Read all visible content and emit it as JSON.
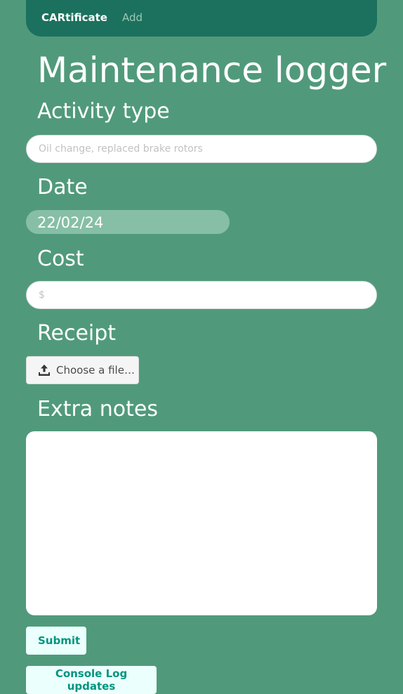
{
  "navbar": {
    "brand": "CARtificate",
    "add_link": "Add"
  },
  "page": {
    "title": "Maintenance logger"
  },
  "form": {
    "activity_label": "Activity type",
    "activity_placeholder": "Oil change, replaced brake rotors",
    "date_label": "Date",
    "date_value": "22/02/24",
    "cost_label": "Cost",
    "cost_placeholder": "$",
    "receipt_label": "Receipt",
    "file_button_label": "Choose a file…",
    "file_button_icon": "upload-icon",
    "notes_label": "Extra notes"
  },
  "actions": {
    "submit_label": "Submit",
    "console_label": "Console Log updates"
  },
  "colors": {
    "background": "#509a7b",
    "navbar": "#1b715e",
    "button_text": "#00947e",
    "button_bg": "#ebfffc",
    "date_field": "#86bfa5"
  }
}
